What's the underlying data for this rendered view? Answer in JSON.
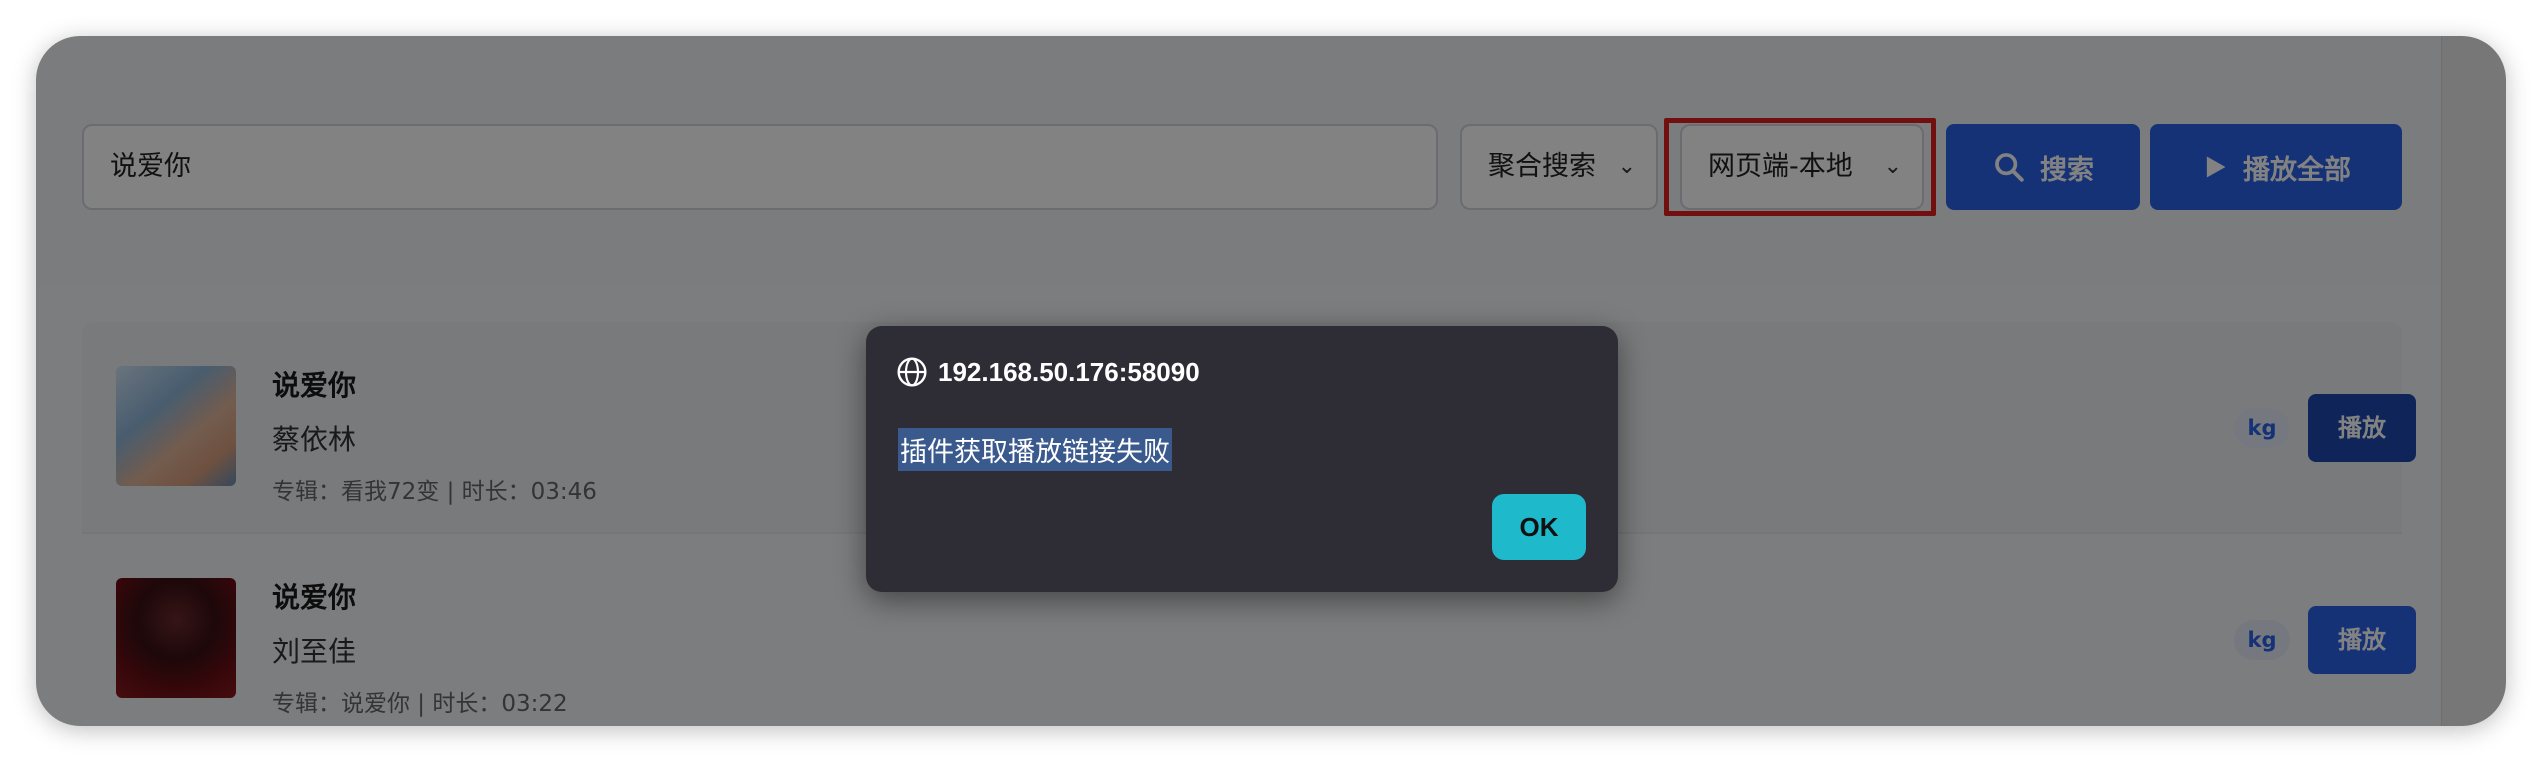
{
  "search": {
    "query": "说爱你",
    "aggregate_select": "聚合搜索",
    "source_select": "网页端-本地",
    "search_button": "搜索",
    "play_all_button": "播放全部"
  },
  "results": [
    {
      "title": "说爱你",
      "artist": "蔡依林",
      "meta": "专辑：看我72变 | 时长：03:46",
      "tag": "kg",
      "play": "播放"
    },
    {
      "title": "说爱你",
      "artist": "刘至佳",
      "meta": "专辑：说爱你 | 时长：03:22",
      "tag": "kg",
      "play": "播放"
    }
  ],
  "dialog": {
    "origin": "192.168.50.176:58090",
    "message": "插件获取播放链接失败",
    "ok_button": "OK"
  },
  "colors": {
    "accent": "#2a62e8",
    "highlight": "#e02020",
    "dialog_bg": "#2e2c34",
    "ok_button": "#1fb9cc"
  }
}
